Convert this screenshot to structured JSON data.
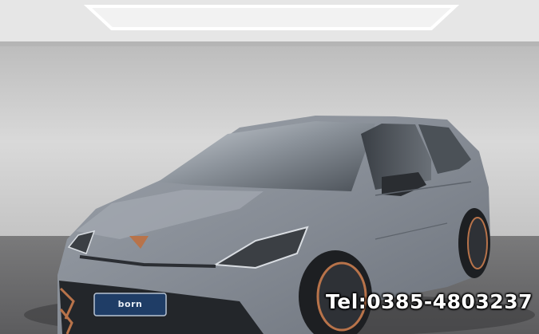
{
  "photo": {
    "plate_text": "born",
    "phone_overlay": "Tel:0385-4803237"
  },
  "colors": {
    "car_body": "#8a9099",
    "wall": "#cfcfcf",
    "floor": "#6f6f70",
    "accent_copper": "#b8734a",
    "plate": "#1f3d66"
  }
}
